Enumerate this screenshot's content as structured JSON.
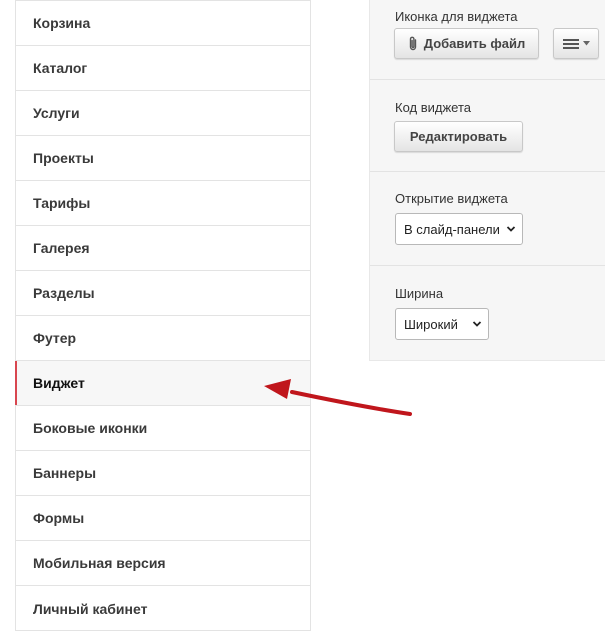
{
  "sidebar": {
    "items": [
      {
        "label": "Корзина"
      },
      {
        "label": "Каталог"
      },
      {
        "label": "Услуги"
      },
      {
        "label": "Проекты"
      },
      {
        "label": "Тарифы"
      },
      {
        "label": "Галерея"
      },
      {
        "label": "Разделы"
      },
      {
        "label": "Футер"
      },
      {
        "label": "Виджет",
        "active": true
      },
      {
        "label": "Боковые иконки"
      },
      {
        "label": "Баннеры"
      },
      {
        "label": "Формы"
      },
      {
        "label": "Мобильная версия"
      },
      {
        "label": "Личный кабинет"
      }
    ]
  },
  "panel": {
    "icon_section": {
      "label": "Иконка для виджета",
      "add_file_button": "Добавить файл",
      "attach_icon": "paperclip-icon",
      "menu_icon": "hamburger-icon"
    },
    "code_section": {
      "label": "Код виджета",
      "edit_button": "Редактировать"
    },
    "open_section": {
      "label": "Открытие виджета",
      "selected": "В слайд-панели"
    },
    "width_section": {
      "label": "Ширина",
      "selected": "Широкий"
    }
  },
  "colors": {
    "active_marker": "#d8464f",
    "arrow": "#c0161c"
  }
}
